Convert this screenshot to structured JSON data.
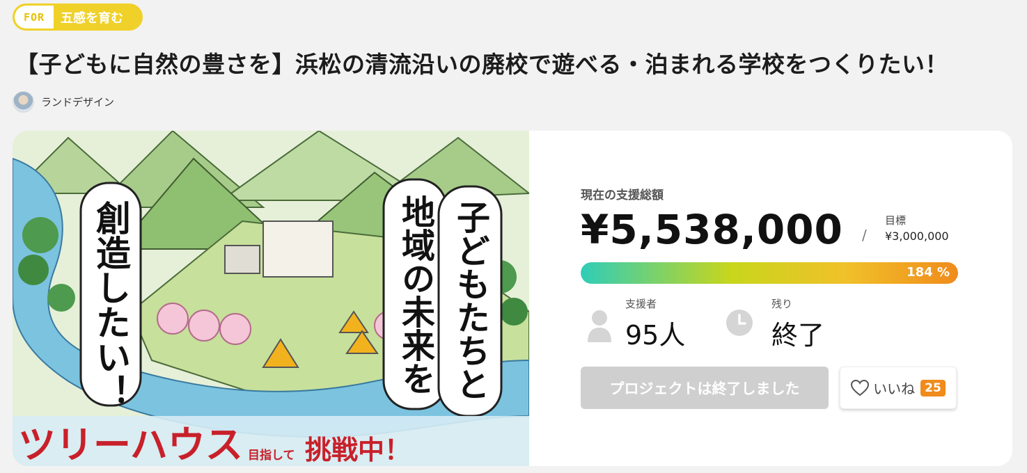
{
  "tag": {
    "for_label": "FOR",
    "text": "五感を育む",
    "color": "#f0d129"
  },
  "project": {
    "title": "【子どもに自然の豊さを】浜松の清流沿いの廃校で遊べる・泊まれる学校をつくりたい！",
    "owner": "ランドデザイン"
  },
  "hero": {
    "image_alt": "illustration-river-school-mountains",
    "vertical_text_1": "子どもたちと",
    "vertical_text_2": "地域の未来を",
    "vertical_text_3": "創造したい！",
    "banner_big": "ツリーハウス",
    "banner_small": "目指して",
    "banner_end": "挑戦中！"
  },
  "stats": {
    "total_label": "現在の支援総額",
    "total_amount": "¥5,538,000",
    "slash": "/",
    "goal_label": "目標",
    "goal_amount": "¥3,000,000",
    "progress_percent": 184,
    "progress_text": "184 %",
    "backers_label": "支援者",
    "backers_value": "95人",
    "remaining_label": "残り",
    "remaining_value": "終了"
  },
  "actions": {
    "ended_button": "プロジェクトは終了しました",
    "like_button": "いいね",
    "like_count": "25"
  },
  "colors": {
    "accent": "#f08b1c",
    "progress_start": "#2fcdb8",
    "banner_red": "#c8202a"
  }
}
